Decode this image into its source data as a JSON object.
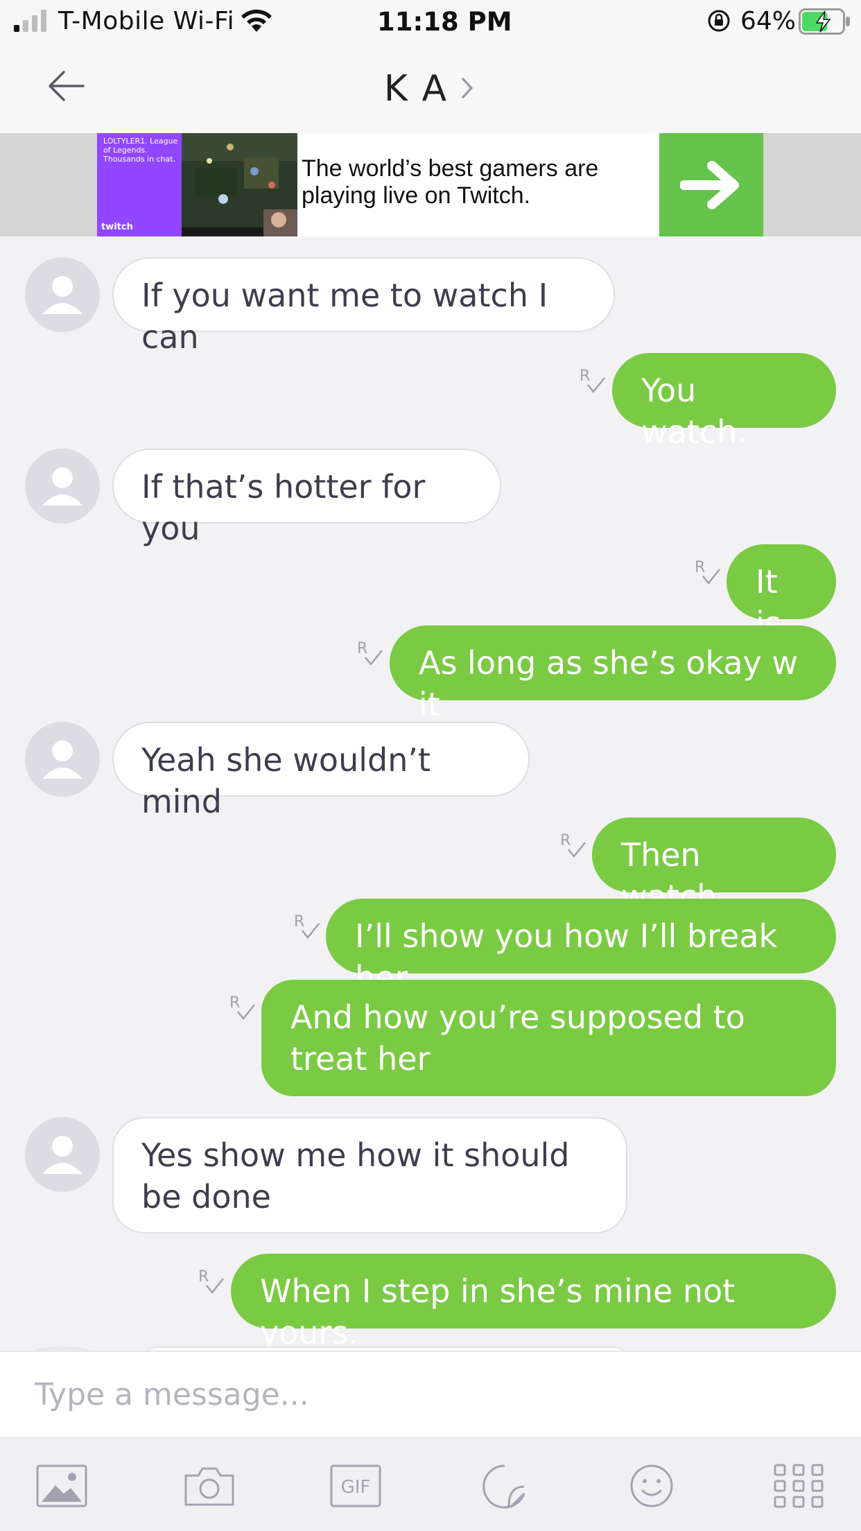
{
  "status_bar": {
    "carrier": "T-Mobile Wi-Fi",
    "time": "11:18 PM",
    "battery_percent": "64%",
    "battery_level": 0.64
  },
  "header": {
    "contact_name": "K A"
  },
  "ad": {
    "streamer_text": "LOLTYLER1. League of Legends. Thousands in chat.",
    "brand": "twitch",
    "headline": "The world’s best gamers are playing live on Twitch.",
    "accent_color": "#9147ff",
    "cta_color": "#63c34a"
  },
  "messages": [
    {
      "direction": "in",
      "text": "If you want me to watch I can"
    },
    {
      "direction": "out",
      "text": "You watch.",
      "read_mark": "R"
    },
    {
      "direction": "in",
      "text": "If that’s hotter for you"
    },
    {
      "direction": "out",
      "text": "It is",
      "read_mark": "R"
    },
    {
      "direction": "out",
      "text": "As long as she’s okay w it",
      "read_mark": "R"
    },
    {
      "direction": "in",
      "text": "Yeah she wouldn’t mind"
    },
    {
      "direction": "out",
      "text": "Then watch.",
      "read_mark": "R"
    },
    {
      "direction": "out",
      "text": "I’ll show you how I’ll break her",
      "read_mark": "R"
    },
    {
      "direction": "out",
      "text": "And how you’re supposed to treat her",
      "read_mark": "R"
    },
    {
      "direction": "in",
      "text": "Yes show me how it should be done"
    },
    {
      "direction": "out",
      "text": "When I step in she’s mine not yours.",
      "read_mark": "R"
    }
  ],
  "composer": {
    "placeholder": "Type a message..."
  },
  "toolbar": {
    "gif_label": "GIF",
    "tools": [
      "image-icon",
      "camera-icon",
      "gif-icon",
      "sticker-icon",
      "emoji-icon",
      "apps-grid-icon"
    ]
  },
  "colors": {
    "outgoing_bubble": "#7aca43",
    "incoming_bubble": "#ffffff",
    "background": "#f2f2f4"
  }
}
